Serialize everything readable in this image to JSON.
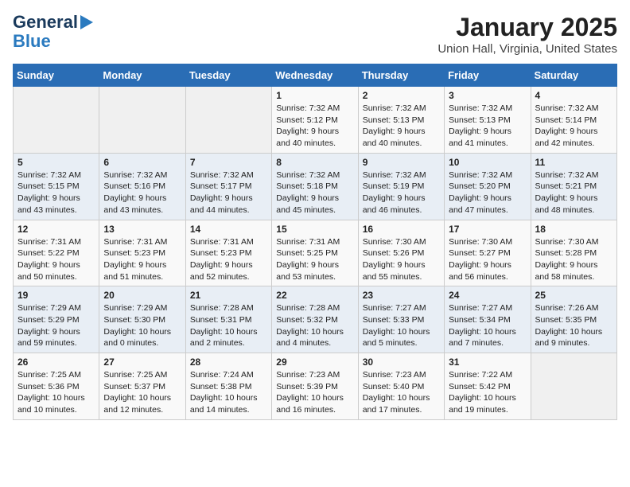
{
  "logo": {
    "line1": "General",
    "line2": "Blue"
  },
  "title": "January 2025",
  "subtitle": "Union Hall, Virginia, United States",
  "days_of_week": [
    "Sunday",
    "Monday",
    "Tuesday",
    "Wednesday",
    "Thursday",
    "Friday",
    "Saturday"
  ],
  "weeks": [
    [
      {
        "num": "",
        "info": ""
      },
      {
        "num": "",
        "info": ""
      },
      {
        "num": "",
        "info": ""
      },
      {
        "num": "1",
        "info": "Sunrise: 7:32 AM\nSunset: 5:12 PM\nDaylight: 9 hours\nand 40 minutes."
      },
      {
        "num": "2",
        "info": "Sunrise: 7:32 AM\nSunset: 5:13 PM\nDaylight: 9 hours\nand 40 minutes."
      },
      {
        "num": "3",
        "info": "Sunrise: 7:32 AM\nSunset: 5:13 PM\nDaylight: 9 hours\nand 41 minutes."
      },
      {
        "num": "4",
        "info": "Sunrise: 7:32 AM\nSunset: 5:14 PM\nDaylight: 9 hours\nand 42 minutes."
      }
    ],
    [
      {
        "num": "5",
        "info": "Sunrise: 7:32 AM\nSunset: 5:15 PM\nDaylight: 9 hours\nand 43 minutes."
      },
      {
        "num": "6",
        "info": "Sunrise: 7:32 AM\nSunset: 5:16 PM\nDaylight: 9 hours\nand 43 minutes."
      },
      {
        "num": "7",
        "info": "Sunrise: 7:32 AM\nSunset: 5:17 PM\nDaylight: 9 hours\nand 44 minutes."
      },
      {
        "num": "8",
        "info": "Sunrise: 7:32 AM\nSunset: 5:18 PM\nDaylight: 9 hours\nand 45 minutes."
      },
      {
        "num": "9",
        "info": "Sunrise: 7:32 AM\nSunset: 5:19 PM\nDaylight: 9 hours\nand 46 minutes."
      },
      {
        "num": "10",
        "info": "Sunrise: 7:32 AM\nSunset: 5:20 PM\nDaylight: 9 hours\nand 47 minutes."
      },
      {
        "num": "11",
        "info": "Sunrise: 7:32 AM\nSunset: 5:21 PM\nDaylight: 9 hours\nand 48 minutes."
      }
    ],
    [
      {
        "num": "12",
        "info": "Sunrise: 7:31 AM\nSunset: 5:22 PM\nDaylight: 9 hours\nand 50 minutes."
      },
      {
        "num": "13",
        "info": "Sunrise: 7:31 AM\nSunset: 5:23 PM\nDaylight: 9 hours\nand 51 minutes."
      },
      {
        "num": "14",
        "info": "Sunrise: 7:31 AM\nSunset: 5:23 PM\nDaylight: 9 hours\nand 52 minutes."
      },
      {
        "num": "15",
        "info": "Sunrise: 7:31 AM\nSunset: 5:25 PM\nDaylight: 9 hours\nand 53 minutes."
      },
      {
        "num": "16",
        "info": "Sunrise: 7:30 AM\nSunset: 5:26 PM\nDaylight: 9 hours\nand 55 minutes."
      },
      {
        "num": "17",
        "info": "Sunrise: 7:30 AM\nSunset: 5:27 PM\nDaylight: 9 hours\nand 56 minutes."
      },
      {
        "num": "18",
        "info": "Sunrise: 7:30 AM\nSunset: 5:28 PM\nDaylight: 9 hours\nand 58 minutes."
      }
    ],
    [
      {
        "num": "19",
        "info": "Sunrise: 7:29 AM\nSunset: 5:29 PM\nDaylight: 9 hours\nand 59 minutes."
      },
      {
        "num": "20",
        "info": "Sunrise: 7:29 AM\nSunset: 5:30 PM\nDaylight: 10 hours\nand 0 minutes."
      },
      {
        "num": "21",
        "info": "Sunrise: 7:28 AM\nSunset: 5:31 PM\nDaylight: 10 hours\nand 2 minutes."
      },
      {
        "num": "22",
        "info": "Sunrise: 7:28 AM\nSunset: 5:32 PM\nDaylight: 10 hours\nand 4 minutes."
      },
      {
        "num": "23",
        "info": "Sunrise: 7:27 AM\nSunset: 5:33 PM\nDaylight: 10 hours\nand 5 minutes."
      },
      {
        "num": "24",
        "info": "Sunrise: 7:27 AM\nSunset: 5:34 PM\nDaylight: 10 hours\nand 7 minutes."
      },
      {
        "num": "25",
        "info": "Sunrise: 7:26 AM\nSunset: 5:35 PM\nDaylight: 10 hours\nand 9 minutes."
      }
    ],
    [
      {
        "num": "26",
        "info": "Sunrise: 7:25 AM\nSunset: 5:36 PM\nDaylight: 10 hours\nand 10 minutes."
      },
      {
        "num": "27",
        "info": "Sunrise: 7:25 AM\nSunset: 5:37 PM\nDaylight: 10 hours\nand 12 minutes."
      },
      {
        "num": "28",
        "info": "Sunrise: 7:24 AM\nSunset: 5:38 PM\nDaylight: 10 hours\nand 14 minutes."
      },
      {
        "num": "29",
        "info": "Sunrise: 7:23 AM\nSunset: 5:39 PM\nDaylight: 10 hours\nand 16 minutes."
      },
      {
        "num": "30",
        "info": "Sunrise: 7:23 AM\nSunset: 5:40 PM\nDaylight: 10 hours\nand 17 minutes."
      },
      {
        "num": "31",
        "info": "Sunrise: 7:22 AM\nSunset: 5:42 PM\nDaylight: 10 hours\nand 19 minutes."
      },
      {
        "num": "",
        "info": ""
      }
    ]
  ]
}
